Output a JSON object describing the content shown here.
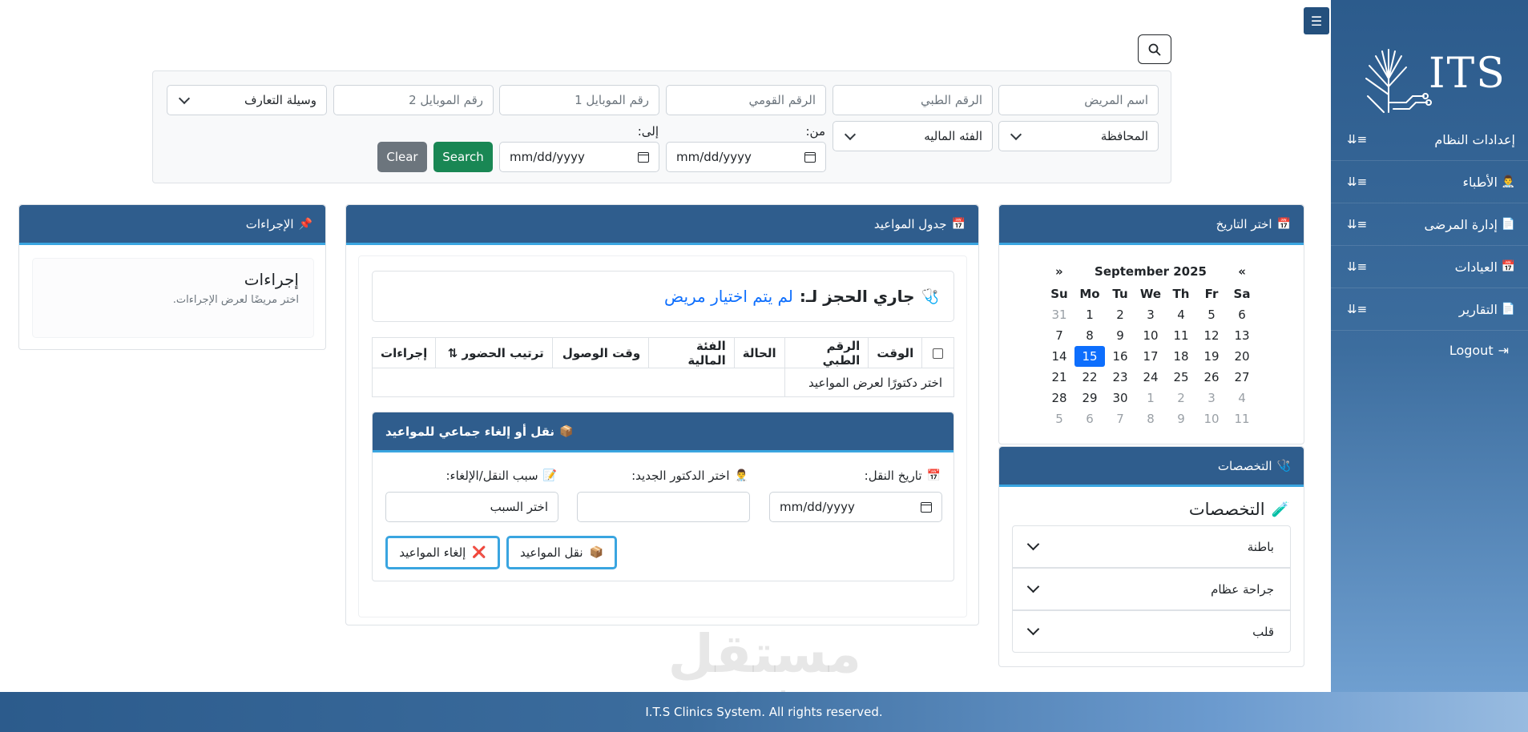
{
  "sidebar": {
    "logo_text": "ITS",
    "items": [
      {
        "label": "إعدادات النظام",
        "icon": ""
      },
      {
        "label": "الأطباء",
        "icon": "👨‍⚕️"
      },
      {
        "label": "إدارة المرضى",
        "icon": "📄"
      },
      {
        "label": "العيادات",
        "icon": "📅"
      },
      {
        "label": "التقارير",
        "icon": "📄"
      }
    ],
    "logout": "Logout"
  },
  "filters": {
    "patient_name": "اسم المريض",
    "medical_no": "الرقم الطبي",
    "national_id": "الرقم القومي",
    "mobile1": "رقم الموبايل 1",
    "mobile2": "رقم الموبايل 2",
    "referral": "وسيلة التعارف",
    "governorate": "المحافظة",
    "financial_category": "الفئه الماليه",
    "from_label": "من:",
    "to_label": "إلى:",
    "date_placeholder": "mm/dd/yyyy",
    "search_btn": "Search",
    "clear_btn": "Clear"
  },
  "date_picker": {
    "title": "اختر التاريخ",
    "icon": "📅",
    "month": "September 2025",
    "prev": "«",
    "next": "»",
    "weekdays": [
      "Su",
      "Mo",
      "Tu",
      "We",
      "Th",
      "Fr",
      "Sa"
    ],
    "weeks": [
      [
        "31",
        "1",
        "2",
        "3",
        "4",
        "5",
        "6"
      ],
      [
        "7",
        "8",
        "9",
        "10",
        "11",
        "12",
        "13"
      ],
      [
        "14",
        "15",
        "16",
        "17",
        "18",
        "19",
        "20"
      ],
      [
        "21",
        "22",
        "23",
        "24",
        "25",
        "26",
        "27"
      ],
      [
        "28",
        "29",
        "30",
        "1",
        "2",
        "3",
        "4"
      ],
      [
        "5",
        "6",
        "7",
        "8",
        "9",
        "10",
        "11"
      ]
    ],
    "selected": "15"
  },
  "specialties": {
    "header": "التخصصات",
    "header_icon": "🩺",
    "title": "التخصصات",
    "title_icon": "🧪",
    "items": [
      "باطنة",
      "جراحة عظام",
      "قلب"
    ]
  },
  "schedule": {
    "header": "جدول المواعيد",
    "header_icon": "📅",
    "booking_prefix": "جاري الحجز لـ:",
    "booking_icon": "🩺",
    "booking_value": "لم يتم اختيار مريض",
    "columns": [
      "الوقت",
      "الرقم الطبي",
      "الحالة",
      "الفئة المالية",
      "وقت الوصول",
      "ترتيب الحضور ⇅",
      "إجراءات"
    ],
    "empty_text": "اختر دكتورًا لعرض المواعيد"
  },
  "bulk": {
    "header": "نقل أو إلغاء جماعي للمواعيد",
    "header_icon": "📦",
    "transfer_date_label": "تاريخ النقل:",
    "transfer_date_icon": "📅",
    "new_doctor_label": "اختر الدكتور الجديد:",
    "new_doctor_icon": "👨‍⚕️",
    "reason_label": "سبب النقل/الإلغاء:",
    "reason_icon": "📝",
    "date_placeholder": "mm/dd/yyyy",
    "reason_placeholder": "اختر السبب",
    "transfer_btn": "نقل المواعيد",
    "transfer_icon": "📦",
    "cancel_btn": "إلغاء المواعيد",
    "cancel_icon": "❌"
  },
  "actions": {
    "header": "الإجراءات",
    "header_icon": "📌",
    "title": "إجراءات",
    "hint": "اختر مريضًا لعرض الإجراءات."
  },
  "footer": {
    "text": "I.T.S Clinics System. All rights reserved."
  },
  "watermark": {
    "arabic": "مستقل",
    "latin": "mostaql.com"
  },
  "colors": {
    "primary": "#2f5d8d",
    "accent": "#3aa5e0",
    "success": "#198754",
    "secondary": "#6c757d",
    "link": "#0d6efd"
  }
}
